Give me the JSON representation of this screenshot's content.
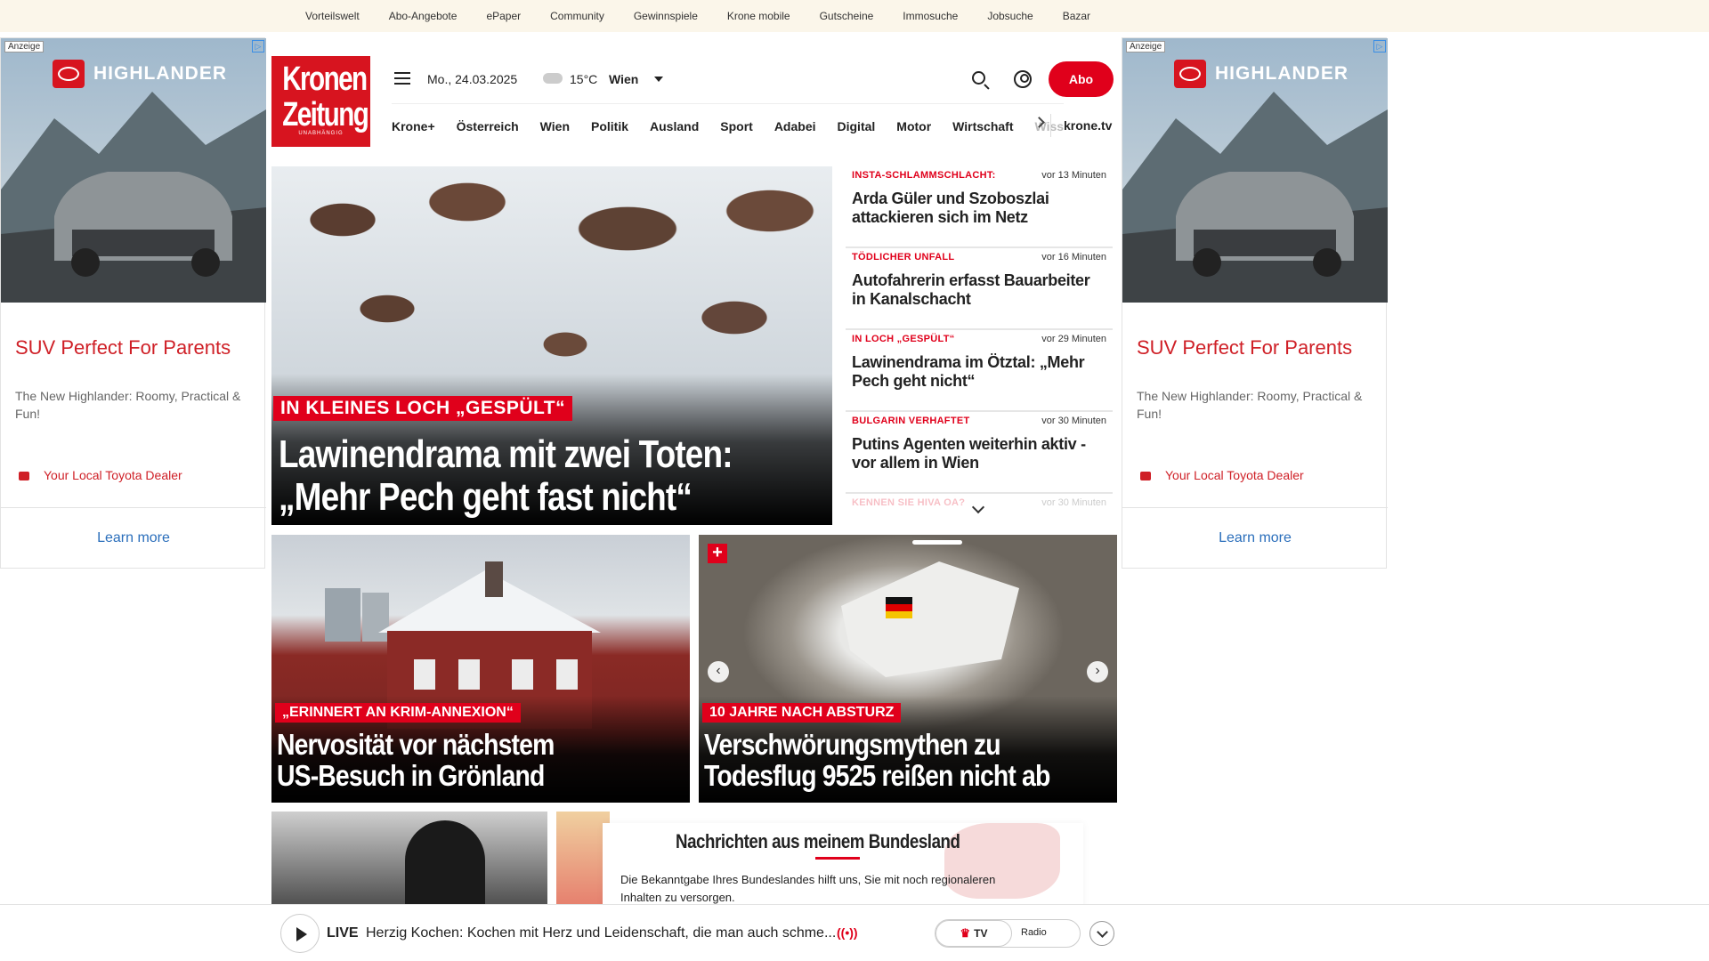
{
  "topnav": [
    "Vorteilswelt",
    "Abo-Angebote",
    "ePaper",
    "Community",
    "Gewinnspiele",
    "Krone mobile",
    "Gutscheine",
    "Immosuche",
    "Jobsuche",
    "Bazar"
  ],
  "ad": {
    "label": "Anzeige",
    "brand": "HIGHLANDER",
    "title": "SUV Perfect For Parents",
    "text": "The New Highlander: Roomy, Practical & Fun!",
    "dealer": "Your Local Toyota Dealer",
    "cta": "Learn more"
  },
  "header": {
    "logo_line1": "Kronen",
    "logo_line2": "Zeitung",
    "logo_tag": "UNABHÄNGIG",
    "date": "Mo., 24.03.2025",
    "temperature": "15°C",
    "city": "Wien",
    "abo": "Abo"
  },
  "nav": {
    "items": [
      "Krone+",
      "Österreich",
      "Wien",
      "Politik",
      "Ausland",
      "Sport",
      "Adabei",
      "Digital",
      "Motor",
      "Wirtschaft"
    ],
    "overflow": "Wiss",
    "tv": "krone.tv"
  },
  "hero": {
    "kicker": "IN KLEINES LOCH „GESPÜLT“",
    "headline_1": "Lawinendrama mit zwei Toten:",
    "headline_2": "„Mehr Pech geht fast nicht“"
  },
  "news": [
    {
      "category": "INSTA-SCHLAMMSCHLACHT:",
      "time": "vor 13 Minuten",
      "title": "Arda Güler und Szoboszlai attackieren sich im Netz"
    },
    {
      "category": "TÖDLICHER UNFALL",
      "time": "vor 16 Minuten",
      "title": "Autofahrerin erfasst Bauarbeiter in Kanalschacht"
    },
    {
      "category": "IN LOCH „GESPÜLT“",
      "time": "vor 29 Minuten",
      "title": "Lawinendrama im Ötztal: „Mehr Pech geht nicht“"
    },
    {
      "category": "BULGARIN VERHAFTET",
      "time": "vor 30 Minuten",
      "title": "Putins Agenten weiterhin aktiv - vor allem in Wien"
    },
    {
      "category": "KENNEN SIE HIVA OA?",
      "time": "vor 30 Minuten",
      "title": ""
    }
  ],
  "cards": [
    {
      "kicker": "„ERINNERT AN KRIM-ANNEXION“",
      "line1": "Nervosität vor nächstem",
      "line2": "US-Besuch in Grönland"
    },
    {
      "kicker": "10 JAHRE NACH ABSTURZ",
      "line1": "Verschwörungsmythen zu",
      "line2": "Todesflug 9525 reißen nicht ab"
    }
  ],
  "bundesland": {
    "title": "Nachrichten aus meinem Bundesland",
    "text": "Die Bekanntgabe Ihres Bundeslandes hilft uns, Sie mit noch regionaleren Inhalten zu versorgen."
  },
  "live": {
    "label": "LIVE",
    "text": "Herzig Kochen: Kochen mit Herz und Leidenschaft, die man auch schme...",
    "tv": "TV",
    "radio": "Radio"
  },
  "colors": {
    "accent": "#e0001b",
    "topbar": "#fbf6ea"
  }
}
